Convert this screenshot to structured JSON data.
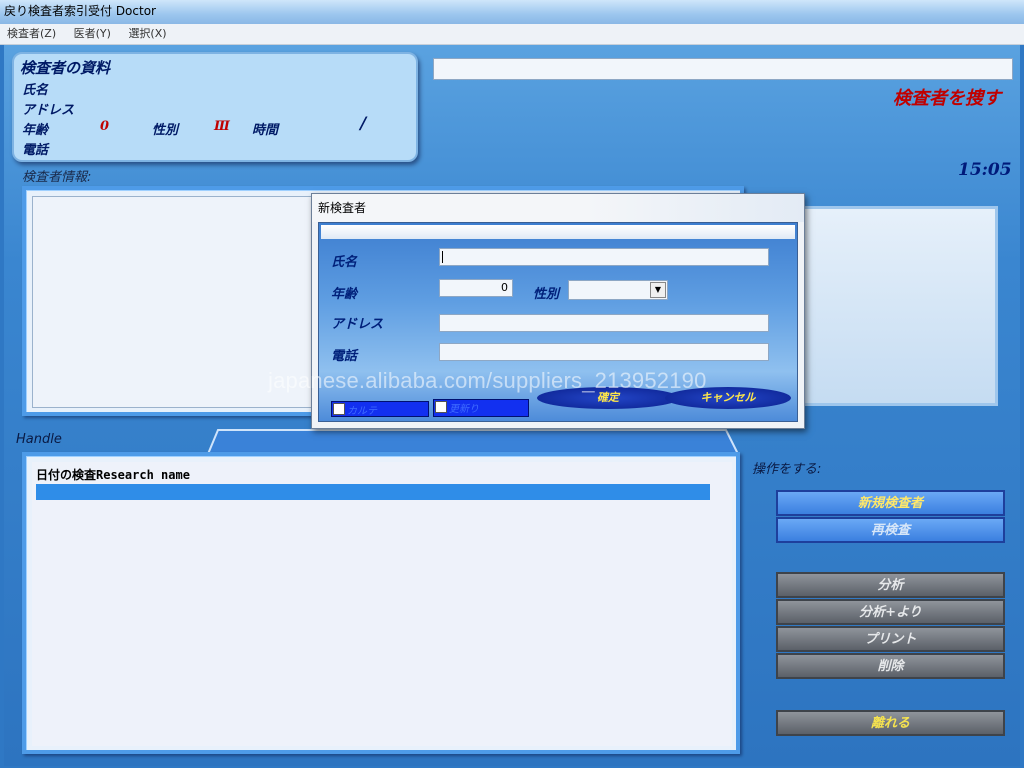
{
  "window": {
    "title": "戻り検査者索引受付 Doctor"
  },
  "menu": [
    "検査者(Z)",
    "医者(Y)",
    "選択(X)"
  ],
  "info": {
    "title": "検査者の資料",
    "name_label": "氏名",
    "address_label": "アドレス",
    "age_label": "年齢",
    "age_value": "0",
    "sex_label": "性別",
    "sex_value": "Ⅲ",
    "time_label": "時間",
    "time_value": "/",
    "phone_label": "電話"
  },
  "search": {
    "value": "",
    "label": "検査者を捜す"
  },
  "clock": "15:05",
  "section": {
    "info_label": "検査者情報:",
    "handle_label": "Handle",
    "ops_label": "操作をする:"
  },
  "list": {
    "header": "日付の検査Research name"
  },
  "buttons": {
    "new_patient": "新規検査者",
    "recheck": "再検査",
    "analyze": "分析",
    "analyze_more": "分析+より",
    "print": "プリント",
    "delete": "削除",
    "leave": "離れる"
  },
  "dialog": {
    "title": "新検査者",
    "name_label": "氏名",
    "age_label": "年齢",
    "age_value": "0",
    "sex_label": "性別",
    "sex_value": "",
    "address_label": "アドレス",
    "phone_label": "電話",
    "check1": "カルテ",
    "check2": "更新り",
    "ok": "確定",
    "cancel": "キャンセル"
  },
  "watermark": "japanese.alibaba.com/suppliers_213952190",
  "colors": {
    "accent": "#2f78c4",
    "gold": "#ffe74a",
    "navy": "#001a66",
    "red": "#c00000"
  }
}
